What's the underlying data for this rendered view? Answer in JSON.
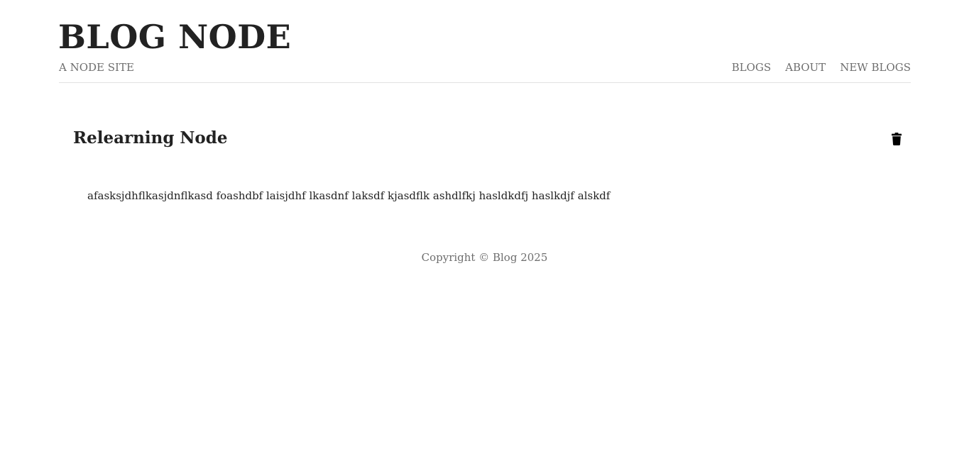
{
  "header": {
    "site_title": "BLOG NODE",
    "site_subtitle": "A NODE SITE",
    "nav": [
      {
        "label": "BLOGS"
      },
      {
        "label": "ABOUT"
      },
      {
        "label": "NEW BLOGS"
      }
    ]
  },
  "post": {
    "title": "Relearning Node",
    "body": "afasksjdhflkasjdnflkasd foashdbf laisjdhf lkasdnf laksdf kjasdflk ashdlfkj hasldkdfj haslkdjf alskdf",
    "delete_icon": "trash-icon"
  },
  "footer": {
    "copyright": "Copyright © Blog 2025"
  },
  "colors": {
    "text": "#222222",
    "muted": "#6e6e6e",
    "divider": "#e2e2e2",
    "icon": "#000000"
  }
}
